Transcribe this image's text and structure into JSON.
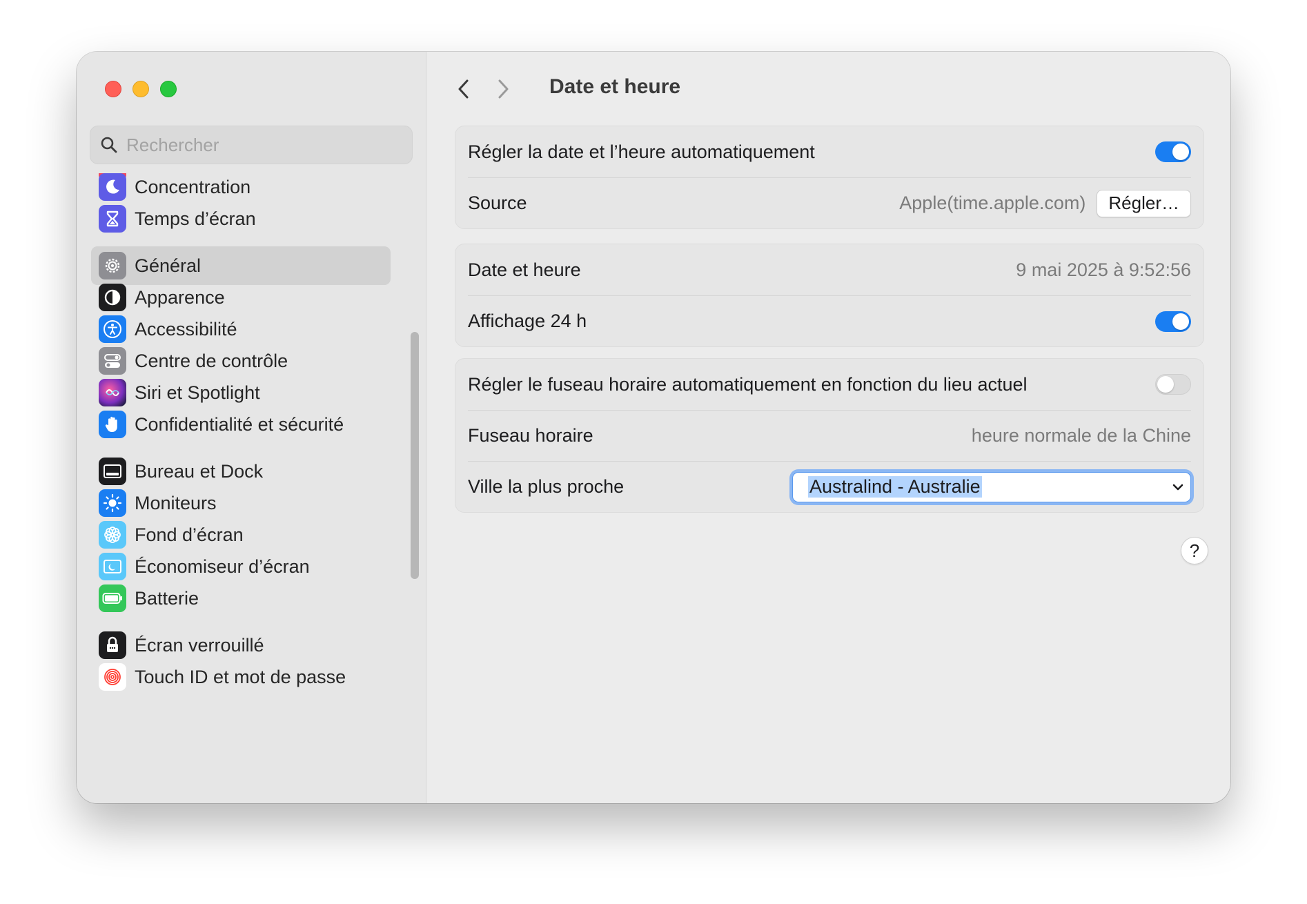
{
  "window": {
    "title": "Date et heure"
  },
  "sidebar": {
    "search_placeholder": "Rechercher",
    "items": [
      {
        "label": "Concentration",
        "icon": "moon-icon",
        "color": "#5e5ce6"
      },
      {
        "label": "Temps d’écran",
        "icon": "hourglass-icon",
        "color": "#5e5ce6"
      },
      {
        "label": "Général",
        "icon": "gear-icon",
        "color": "#8e8e93",
        "selected": true
      },
      {
        "label": "Apparence",
        "icon": "appearance-icon",
        "color": "#1d1d1f"
      },
      {
        "label": "Accessibilité",
        "icon": "accessibility-icon",
        "color": "#1a7ef2"
      },
      {
        "label": "Centre de contrôle",
        "icon": "control-center-icon",
        "color": "#8e8e93"
      },
      {
        "label": "Siri et Spotlight",
        "icon": "siri-icon",
        "color": "#7b2fbe"
      },
      {
        "label": "Confidentialité et sécurité",
        "icon": "hand-icon",
        "color": "#1a7ef2"
      },
      {
        "label": "Bureau et Dock",
        "icon": "dock-icon",
        "color": "#1d1d1f"
      },
      {
        "label": "Moniteurs",
        "icon": "brightness-icon",
        "color": "#1a7ef2"
      },
      {
        "label": "Fond d’écran",
        "icon": "flower-icon",
        "color": "#5ac8fa"
      },
      {
        "label": "Économiseur d’écran",
        "icon": "screensaver-icon",
        "color": "#5ac8fa"
      },
      {
        "label": "Batterie",
        "icon": "battery-icon",
        "color": "#34c759"
      },
      {
        "label": "Écran verrouillé",
        "icon": "lock-icon",
        "color": "#1d1d1f"
      },
      {
        "label": "Touch ID et mot de passe",
        "icon": "fingerprint-icon",
        "color": "#ff3b30"
      }
    ]
  },
  "main": {
    "title": "Date et heure",
    "card1": {
      "auto_label": "Régler la date et l’heure automatiquement",
      "auto_on": true,
      "source_label": "Source",
      "source_value": "Apple(time.apple.com)",
      "source_button": "Régler…"
    },
    "card2": {
      "datetime_label": "Date et heure",
      "datetime_value": "9 mai 2025 à 9:52:56",
      "h24_label": "Affichage 24 h",
      "h24_on": true
    },
    "card3": {
      "tz_auto_label": "Régler le fuseau horaire automatiquement en fonction du lieu actuel",
      "tz_auto_on": false,
      "tz_label": "Fuseau horaire",
      "tz_value": "heure normale de la Chine",
      "city_label": "Ville la plus proche",
      "city_value": "Australind - Australie"
    },
    "help_label": "?"
  },
  "colors": {
    "accent": "#1a7ef2",
    "toggle_off": "#dcdcdc",
    "focus_ring": "#8ab6f3"
  }
}
